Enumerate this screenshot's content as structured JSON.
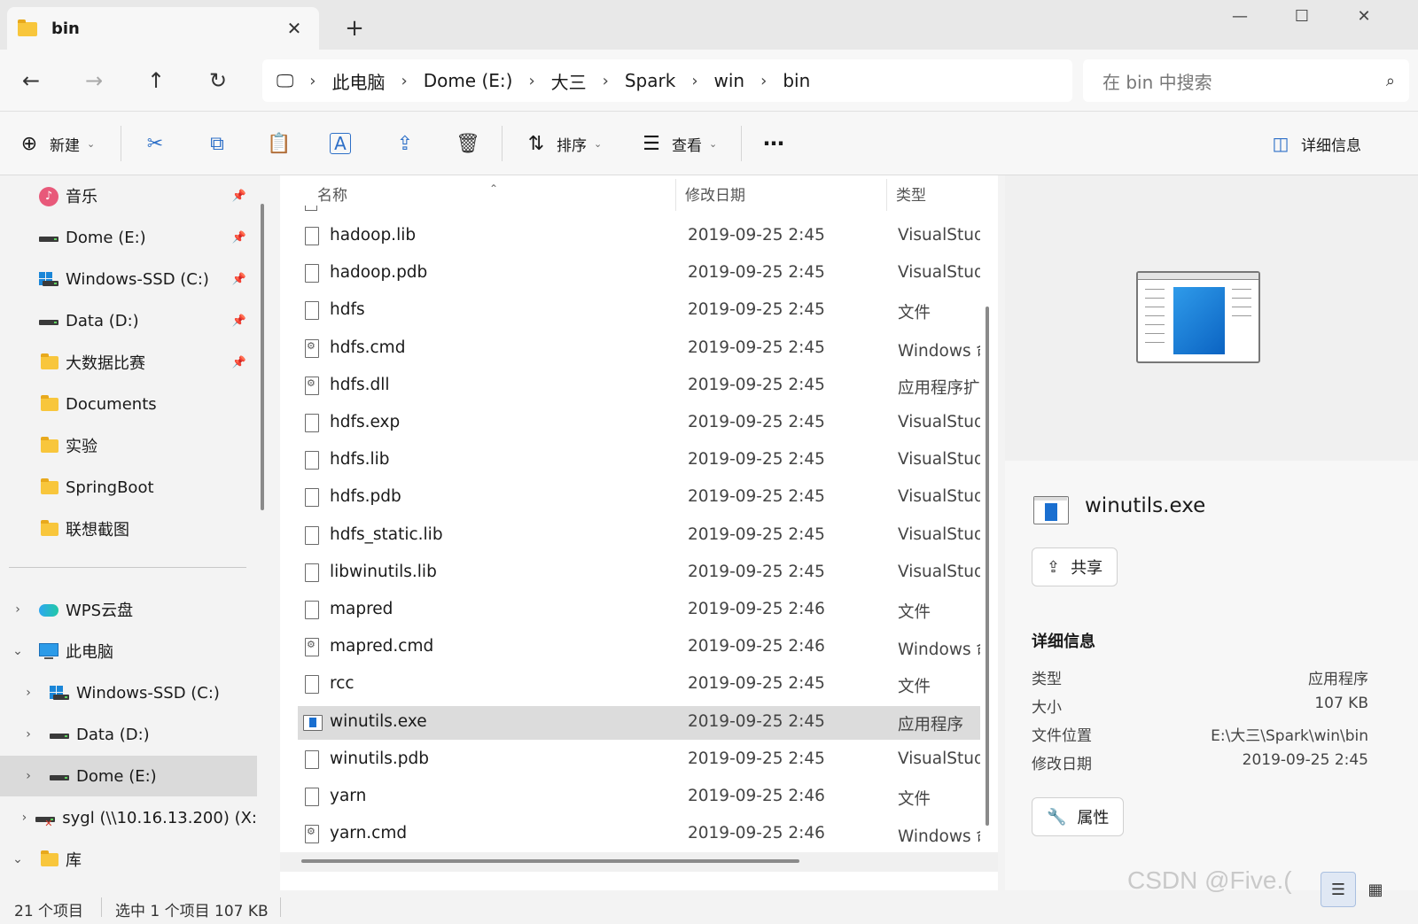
{
  "tab": {
    "title": "bin"
  },
  "address": {
    "segments": [
      "此电脑",
      "Dome (E:)",
      "大三",
      "Spark",
      "win",
      "bin"
    ]
  },
  "search": {
    "placeholder": "在 bin 中搜索"
  },
  "commandbar": {
    "new_label": "新建",
    "sort_label": "排序",
    "view_label": "查看",
    "details_label": "详细信息"
  },
  "nav": {
    "quick": [
      {
        "label": "音乐",
        "pinned": true
      },
      {
        "label": "Dome (E:)",
        "pinned": true
      },
      {
        "label": "Windows-SSD (C:)",
        "pinned": true
      },
      {
        "label": "Data (D:)",
        "pinned": true
      },
      {
        "label": "大数据比赛",
        "pinned": true
      },
      {
        "label": "Documents",
        "pinned": false
      },
      {
        "label": "实验",
        "pinned": false
      },
      {
        "label": "SpringBoot",
        "pinned": false
      },
      {
        "label": "联想截图",
        "pinned": false
      }
    ],
    "tree": [
      {
        "label": "WPS云盘"
      },
      {
        "label": "此电脑"
      },
      {
        "label": "Windows-SSD (C:)"
      },
      {
        "label": "Data (D:)"
      },
      {
        "label": "Dome (E:)"
      },
      {
        "label": "sygl (\\\\10.16.13.200) (X:"
      },
      {
        "label": "库"
      }
    ]
  },
  "columns": {
    "name": "名称",
    "modified": "修改日期",
    "type": "类型"
  },
  "files": [
    {
      "name": "hadoop.lib",
      "date": "2019-09-25 2:45",
      "type": "VisualStudi",
      "icon": "doc"
    },
    {
      "name": "hadoop.pdb",
      "date": "2019-09-25 2:45",
      "type": "VisualStudi",
      "icon": "doc"
    },
    {
      "name": "hdfs",
      "date": "2019-09-25 2:45",
      "type": "文件",
      "icon": "doc"
    },
    {
      "name": "hdfs.cmd",
      "date": "2019-09-25 2:45",
      "type": "Windows 命",
      "icon": "cmd"
    },
    {
      "name": "hdfs.dll",
      "date": "2019-09-25 2:45",
      "type": "应用程序扩展",
      "icon": "cmd"
    },
    {
      "name": "hdfs.exp",
      "date": "2019-09-25 2:45",
      "type": "VisualStudi",
      "icon": "doc"
    },
    {
      "name": "hdfs.lib",
      "date": "2019-09-25 2:45",
      "type": "VisualStudi",
      "icon": "doc"
    },
    {
      "name": "hdfs.pdb",
      "date": "2019-09-25 2:45",
      "type": "VisualStudi",
      "icon": "doc"
    },
    {
      "name": "hdfs_static.lib",
      "date": "2019-09-25 2:45",
      "type": "VisualStudi",
      "icon": "doc"
    },
    {
      "name": "libwinutils.lib",
      "date": "2019-09-25 2:45",
      "type": "VisualStudi",
      "icon": "doc"
    },
    {
      "name": "mapred",
      "date": "2019-09-25 2:46",
      "type": "文件",
      "icon": "doc"
    },
    {
      "name": "mapred.cmd",
      "date": "2019-09-25 2:46",
      "type": "Windows 命",
      "icon": "cmd"
    },
    {
      "name": "rcc",
      "date": "2019-09-25 2:45",
      "type": "文件",
      "icon": "doc"
    },
    {
      "name": "winutils.exe",
      "date": "2019-09-25 2:45",
      "type": "应用程序",
      "icon": "exe",
      "selected": true
    },
    {
      "name": "winutils.pdb",
      "date": "2019-09-25 2:45",
      "type": "VisualStudi",
      "icon": "doc"
    },
    {
      "name": "yarn",
      "date": "2019-09-25 2:46",
      "type": "文件",
      "icon": "doc"
    },
    {
      "name": "yarn.cmd",
      "date": "2019-09-25 2:46",
      "type": "Windows 命",
      "icon": "cmd"
    }
  ],
  "details": {
    "filename": "winutils.exe",
    "share_label": "共享",
    "section_title": "详细信息",
    "rows": [
      {
        "key": "类型",
        "value": "应用程序"
      },
      {
        "key": "大小",
        "value": "107 KB"
      },
      {
        "key": "文件位置",
        "value": "E:\\大三\\Spark\\win\\bin"
      },
      {
        "key": "修改日期",
        "value": "2019-09-25 2:45"
      }
    ],
    "properties_label": "属性"
  },
  "status": {
    "count": "21 个项目",
    "selection": "选中 1 个项目  107 KB"
  },
  "watermark": "CSDN @Five.("
}
